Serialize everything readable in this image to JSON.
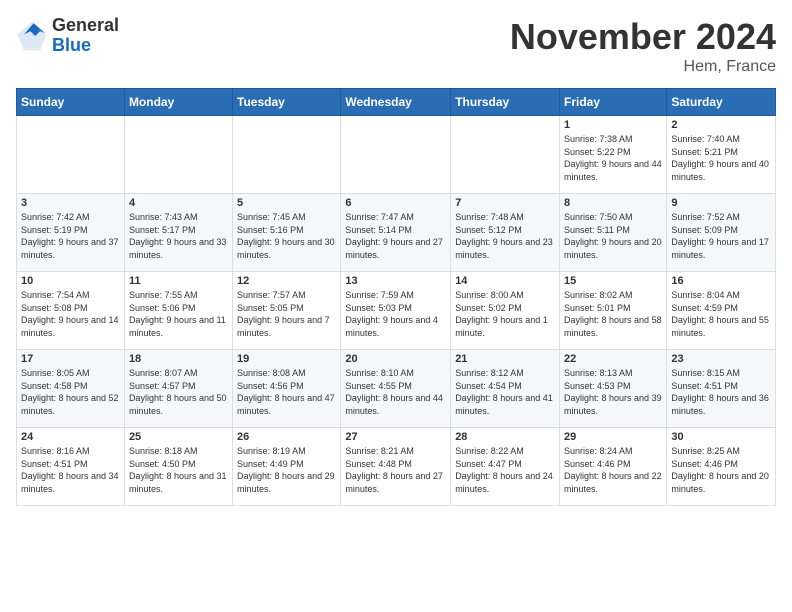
{
  "logo": {
    "general": "General",
    "blue": "Blue"
  },
  "title": "November 2024",
  "location": "Hem, France",
  "weekdays": [
    "Sunday",
    "Monday",
    "Tuesday",
    "Wednesday",
    "Thursday",
    "Friday",
    "Saturday"
  ],
  "weeks": [
    [
      {
        "day": "",
        "info": ""
      },
      {
        "day": "",
        "info": ""
      },
      {
        "day": "",
        "info": ""
      },
      {
        "day": "",
        "info": ""
      },
      {
        "day": "",
        "info": ""
      },
      {
        "day": "1",
        "sunrise": "Sunrise: 7:38 AM",
        "sunset": "Sunset: 5:22 PM",
        "daylight": "Daylight: 9 hours and 44 minutes."
      },
      {
        "day": "2",
        "sunrise": "Sunrise: 7:40 AM",
        "sunset": "Sunset: 5:21 PM",
        "daylight": "Daylight: 9 hours and 40 minutes."
      }
    ],
    [
      {
        "day": "3",
        "sunrise": "Sunrise: 7:42 AM",
        "sunset": "Sunset: 5:19 PM",
        "daylight": "Daylight: 9 hours and 37 minutes."
      },
      {
        "day": "4",
        "sunrise": "Sunrise: 7:43 AM",
        "sunset": "Sunset: 5:17 PM",
        "daylight": "Daylight: 9 hours and 33 minutes."
      },
      {
        "day": "5",
        "sunrise": "Sunrise: 7:45 AM",
        "sunset": "Sunset: 5:16 PM",
        "daylight": "Daylight: 9 hours and 30 minutes."
      },
      {
        "day": "6",
        "sunrise": "Sunrise: 7:47 AM",
        "sunset": "Sunset: 5:14 PM",
        "daylight": "Daylight: 9 hours and 27 minutes."
      },
      {
        "day": "7",
        "sunrise": "Sunrise: 7:48 AM",
        "sunset": "Sunset: 5:12 PM",
        "daylight": "Daylight: 9 hours and 23 minutes."
      },
      {
        "day": "8",
        "sunrise": "Sunrise: 7:50 AM",
        "sunset": "Sunset: 5:11 PM",
        "daylight": "Daylight: 9 hours and 20 minutes."
      },
      {
        "day": "9",
        "sunrise": "Sunrise: 7:52 AM",
        "sunset": "Sunset: 5:09 PM",
        "daylight": "Daylight: 9 hours and 17 minutes."
      }
    ],
    [
      {
        "day": "10",
        "sunrise": "Sunrise: 7:54 AM",
        "sunset": "Sunset: 5:08 PM",
        "daylight": "Daylight: 9 hours and 14 minutes."
      },
      {
        "day": "11",
        "sunrise": "Sunrise: 7:55 AM",
        "sunset": "Sunset: 5:06 PM",
        "daylight": "Daylight: 9 hours and 11 minutes."
      },
      {
        "day": "12",
        "sunrise": "Sunrise: 7:57 AM",
        "sunset": "Sunset: 5:05 PM",
        "daylight": "Daylight: 9 hours and 7 minutes."
      },
      {
        "day": "13",
        "sunrise": "Sunrise: 7:59 AM",
        "sunset": "Sunset: 5:03 PM",
        "daylight": "Daylight: 9 hours and 4 minutes."
      },
      {
        "day": "14",
        "sunrise": "Sunrise: 8:00 AM",
        "sunset": "Sunset: 5:02 PM",
        "daylight": "Daylight: 9 hours and 1 minute."
      },
      {
        "day": "15",
        "sunrise": "Sunrise: 8:02 AM",
        "sunset": "Sunset: 5:01 PM",
        "daylight": "Daylight: 8 hours and 58 minutes."
      },
      {
        "day": "16",
        "sunrise": "Sunrise: 8:04 AM",
        "sunset": "Sunset: 4:59 PM",
        "daylight": "Daylight: 8 hours and 55 minutes."
      }
    ],
    [
      {
        "day": "17",
        "sunrise": "Sunrise: 8:05 AM",
        "sunset": "Sunset: 4:58 PM",
        "daylight": "Daylight: 8 hours and 52 minutes."
      },
      {
        "day": "18",
        "sunrise": "Sunrise: 8:07 AM",
        "sunset": "Sunset: 4:57 PM",
        "daylight": "Daylight: 8 hours and 50 minutes."
      },
      {
        "day": "19",
        "sunrise": "Sunrise: 8:08 AM",
        "sunset": "Sunset: 4:56 PM",
        "daylight": "Daylight: 8 hours and 47 minutes."
      },
      {
        "day": "20",
        "sunrise": "Sunrise: 8:10 AM",
        "sunset": "Sunset: 4:55 PM",
        "daylight": "Daylight: 8 hours and 44 minutes."
      },
      {
        "day": "21",
        "sunrise": "Sunrise: 8:12 AM",
        "sunset": "Sunset: 4:54 PM",
        "daylight": "Daylight: 8 hours and 41 minutes."
      },
      {
        "day": "22",
        "sunrise": "Sunrise: 8:13 AM",
        "sunset": "Sunset: 4:53 PM",
        "daylight": "Daylight: 8 hours and 39 minutes."
      },
      {
        "day": "23",
        "sunrise": "Sunrise: 8:15 AM",
        "sunset": "Sunset: 4:51 PM",
        "daylight": "Daylight: 8 hours and 36 minutes."
      }
    ],
    [
      {
        "day": "24",
        "sunrise": "Sunrise: 8:16 AM",
        "sunset": "Sunset: 4:51 PM",
        "daylight": "Daylight: 8 hours and 34 minutes."
      },
      {
        "day": "25",
        "sunrise": "Sunrise: 8:18 AM",
        "sunset": "Sunset: 4:50 PM",
        "daylight": "Daylight: 8 hours and 31 minutes."
      },
      {
        "day": "26",
        "sunrise": "Sunrise: 8:19 AM",
        "sunset": "Sunset: 4:49 PM",
        "daylight": "Daylight: 8 hours and 29 minutes."
      },
      {
        "day": "27",
        "sunrise": "Sunrise: 8:21 AM",
        "sunset": "Sunset: 4:48 PM",
        "daylight": "Daylight: 8 hours and 27 minutes."
      },
      {
        "day": "28",
        "sunrise": "Sunrise: 8:22 AM",
        "sunset": "Sunset: 4:47 PM",
        "daylight": "Daylight: 8 hours and 24 minutes."
      },
      {
        "day": "29",
        "sunrise": "Sunrise: 8:24 AM",
        "sunset": "Sunset: 4:46 PM",
        "daylight": "Daylight: 8 hours and 22 minutes."
      },
      {
        "day": "30",
        "sunrise": "Sunrise: 8:25 AM",
        "sunset": "Sunset: 4:46 PM",
        "daylight": "Daylight: 8 hours and 20 minutes."
      }
    ]
  ]
}
